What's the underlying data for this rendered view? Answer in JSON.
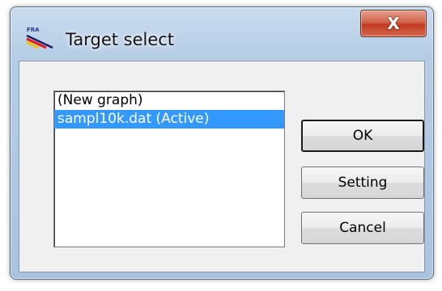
{
  "window": {
    "title": "Target select",
    "close_label": "X",
    "app_icon": "fra-graph-icon",
    "app_icon_text": "FRA"
  },
  "targets": {
    "items": [
      {
        "label": "(New graph)",
        "selected": false
      },
      {
        "label": "sampl10k.dat (Active)",
        "selected": true
      }
    ]
  },
  "buttons": {
    "ok_label": "OK",
    "setting_label": "Setting",
    "cancel_label": "Cancel"
  },
  "colors": {
    "selection": "#3399ff",
    "close_button": "#c2391f"
  }
}
